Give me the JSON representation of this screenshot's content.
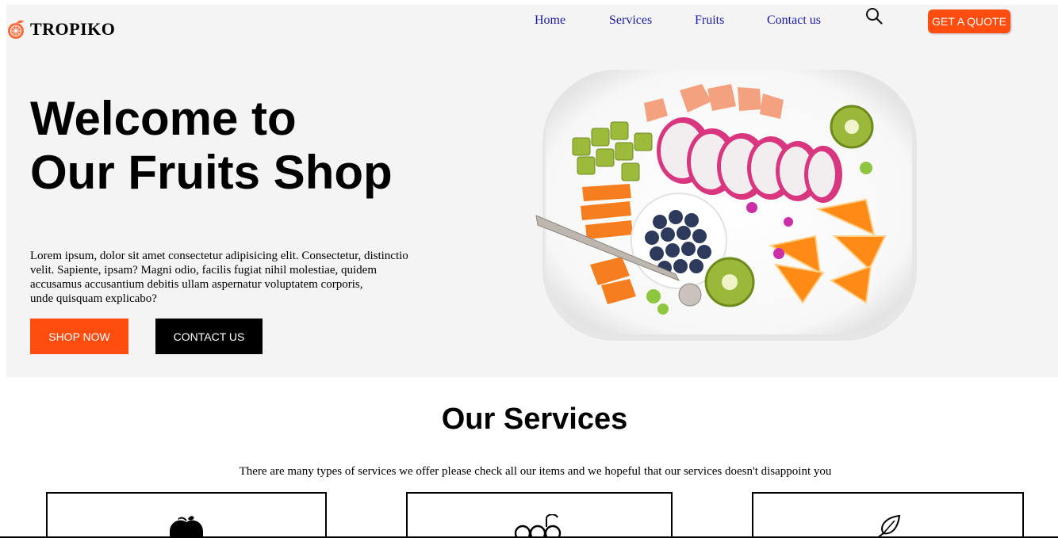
{
  "brand": {
    "name": "TROPIKO"
  },
  "nav": {
    "items": [
      {
        "label": "Home"
      },
      {
        "label": "Services"
      },
      {
        "label": "Fruits"
      },
      {
        "label": "Contact us"
      }
    ],
    "search_icon": "search-icon",
    "quote_label": "GET A QUOTE"
  },
  "hero": {
    "title_line1": "Welcome to",
    "title_line2": "Our Fruits Shop",
    "desc_line1": "Lorem ipsum, dolor sit amet consectetur adipisicing elit. Consectetur, distinctio",
    "desc_line2": "velit. Sapiente, ipsam? Magni odio, facilis fugiat nihil molestiae, quidem",
    "desc_line3": "accusamus accusantium debitis ullam aspernatur voluptatem corporis,",
    "desc_line4": "unde quisquam explicabo?",
    "shop_label": "SHOP NOW",
    "contact_label": "CONTACT US"
  },
  "services": {
    "title": "Our Services",
    "subtitle": "There are many types of services we offer please check all our items and we hopeful that our services doesn't disappoint you",
    "cards": [
      {
        "icon": "apple-icon"
      },
      {
        "icon": "grapes-icon"
      },
      {
        "icon": "leaf-icon"
      }
    ]
  },
  "colors": {
    "accent": "#ff4c0f",
    "hero_bg": "#f4f4f5",
    "nav_link": "#1a1aa6",
    "dark": "#000000"
  }
}
